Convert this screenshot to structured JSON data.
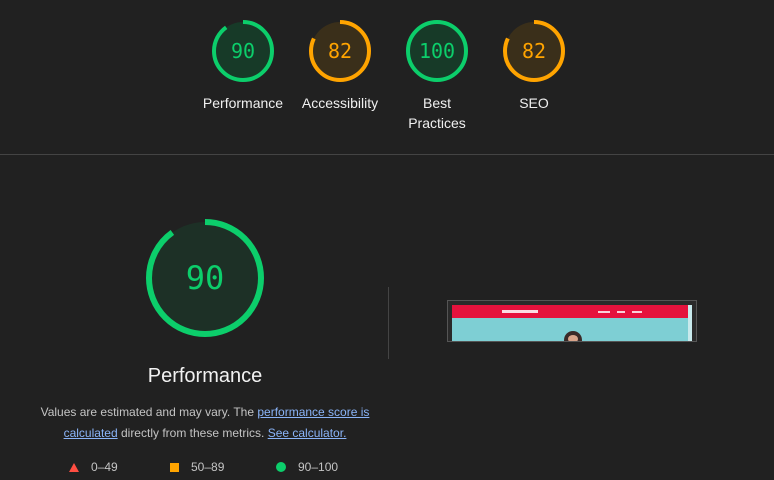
{
  "summary": {
    "categories": [
      {
        "label": "Performance",
        "score": "90",
        "score_fraction": 0.9,
        "color": "#0cce6b",
        "fill": "#173a28"
      },
      {
        "label": "Accessibility",
        "score": "82",
        "score_fraction": 0.82,
        "color": "#ffa400",
        "fill": "#3a2f1a"
      },
      {
        "label": "Best Practices",
        "score": "100",
        "score_fraction": 1.0,
        "color": "#0cce6b",
        "fill": "#173a28"
      },
      {
        "label": "SEO",
        "score": "82",
        "score_fraction": 0.82,
        "color": "#ffa400",
        "fill": "#3a2f1a"
      }
    ]
  },
  "performance": {
    "score": "90",
    "score_fraction": 0.9,
    "color": "#0cce6b",
    "title": "Performance",
    "desc_prefix": "Values are estimated and may vary. The ",
    "desc_link1": "performance score is calculated",
    "desc_middle": " directly from these metrics. ",
    "desc_link2": "See calculator."
  },
  "legend": {
    "fail": {
      "range": "0–49",
      "color": "#ff4e42"
    },
    "average": {
      "range": "50–89",
      "color": "#ffa400"
    },
    "pass": {
      "range": "90–100",
      "color": "#0cce6b"
    }
  },
  "thumbnail": {
    "bar_color": "#e5123d",
    "hero_color": "#7ecfd4"
  }
}
